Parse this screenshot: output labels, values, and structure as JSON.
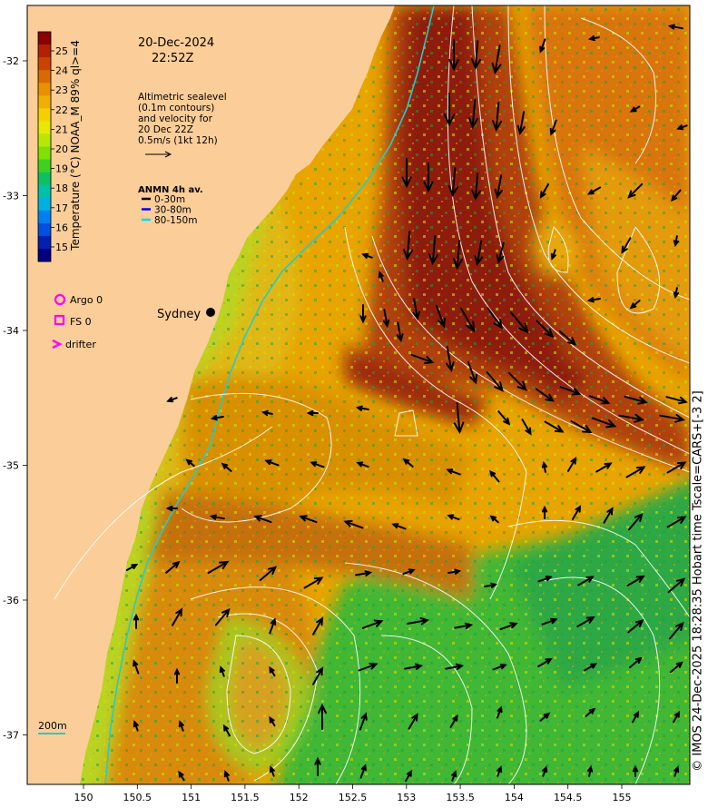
{
  "header": {
    "date": "20-Dec-2024",
    "time": "22:52Z"
  },
  "altimetry_note": [
    "Altimetric sealevel",
    "(0.1m contours)",
    "and velocity for",
    "20 Dec 22Z",
    "0.5m/s (1kt 12h)"
  ],
  "anmn": {
    "title": "ANMN 4h av.",
    "items": [
      {
        "label": "0-30m",
        "color": "#000000"
      },
      {
        "label": "30-80m",
        "color": "#0000ee"
      },
      {
        "label": "80-150m",
        "color": "#00d8ff"
      }
    ]
  },
  "obs_legend": [
    {
      "label": "Argo 0",
      "symbol": "circle",
      "color": "#ff00ff"
    },
    {
      "label": "FS 0",
      "symbol": "square",
      "color": "#ff00ff"
    },
    {
      "label": "drifter",
      "symbol": "chevron",
      "color": "#ff00ff"
    }
  ],
  "city": {
    "label": "Sydney"
  },
  "isobath_label": "200m",
  "colorbar": {
    "label": "Temperature (°C) NOAA_M 89% ql>=4",
    "ticks": [
      "25",
      "24",
      "23",
      "22",
      "21",
      "20",
      "19",
      "18",
      "17",
      "16",
      "15"
    ],
    "colors": [
      "#8b0000",
      "#b22200",
      "#c84400",
      "#d86a00",
      "#e89000",
      "#f0b000",
      "#f4d000",
      "#e8e800",
      "#b8e800",
      "#80e000",
      "#40d020",
      "#10c060",
      "#00c0a8",
      "#00b0e0",
      "#0080f0",
      "#0050e0",
      "#0020b0",
      "#000080"
    ]
  },
  "axes": {
    "lon_ticks": [
      "150",
      "150.5",
      "151",
      "151.5",
      "152",
      "152.5",
      "153",
      "153.5",
      "154",
      "154.5",
      "155"
    ],
    "lat_ticks": [
      "-32",
      "-33",
      "-34",
      "-35",
      "-36",
      "-37"
    ]
  },
  "credit": "© IMOS 24-Dec-2025 18:28:35 Hobart time Tscale=CARS+[-3 2]",
  "colors": {
    "land": "#fbcd98",
    "warm_core": "#a83a0a",
    "shelf_water": "#d8780c",
    "cool_water": "#4cbb32",
    "isobath": "#22cccc",
    "contour": "#ffffff"
  }
}
